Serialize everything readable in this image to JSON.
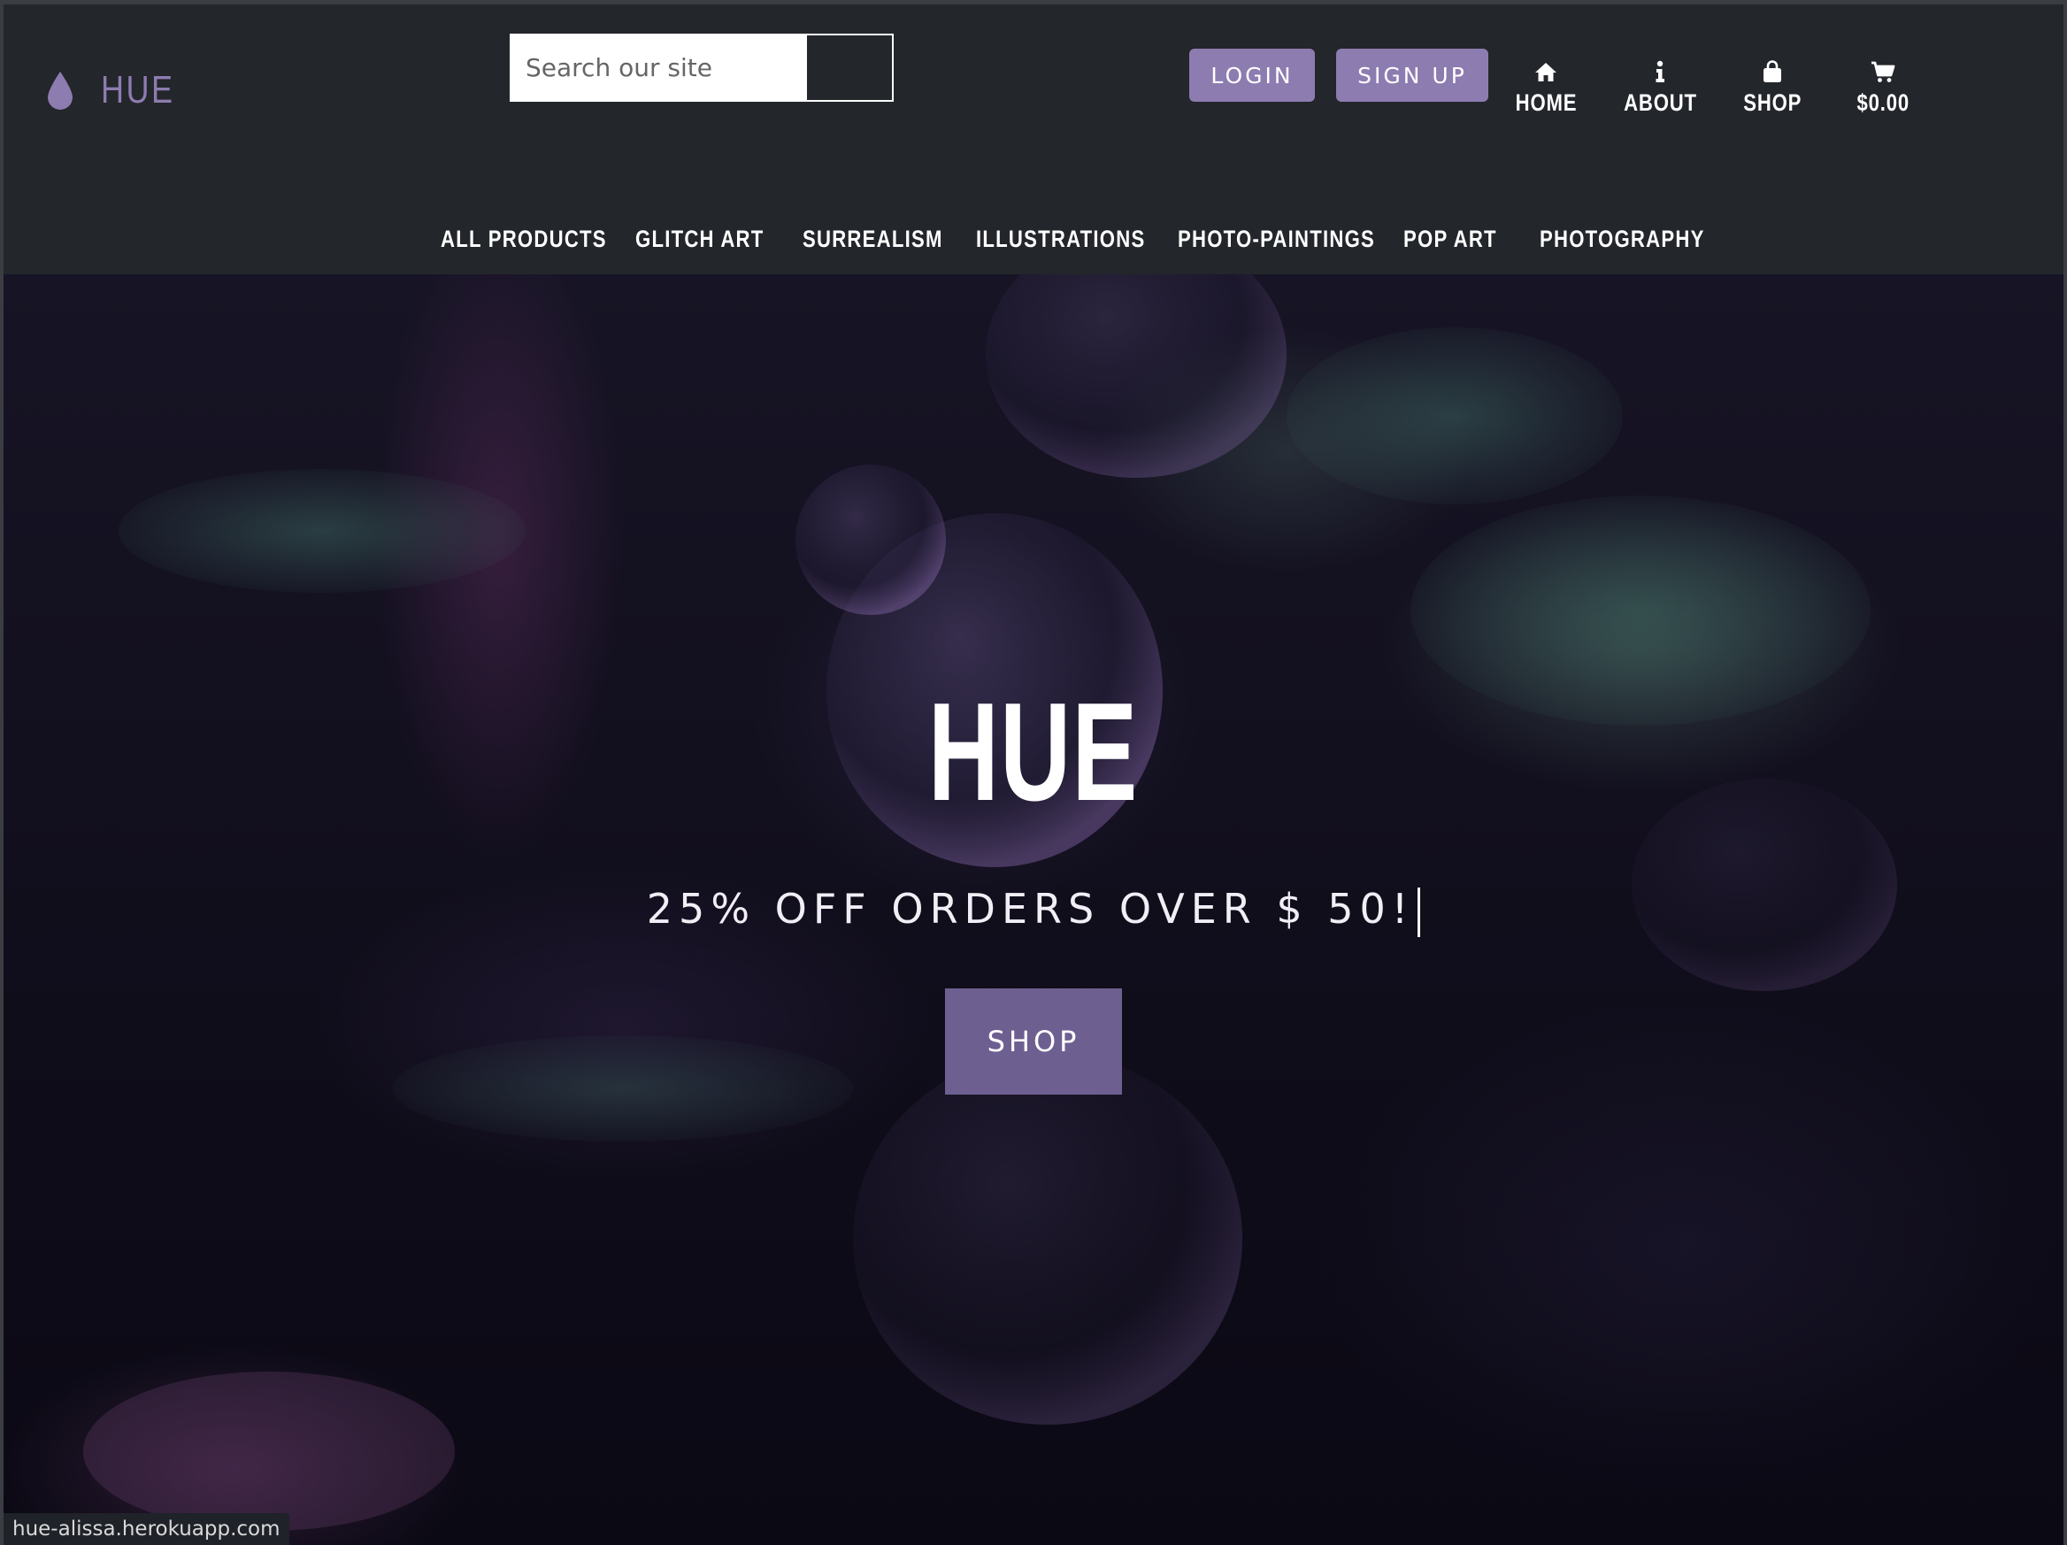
{
  "header": {
    "brand": {
      "icon": "droplet-icon",
      "name": "HUE"
    },
    "search": {
      "placeholder": "Search our site",
      "value": ""
    },
    "auth": {
      "login_label": "LOGIN",
      "signup_label": "SIGN UP"
    },
    "nav": [
      {
        "icon": "home-icon",
        "label": "HOME"
      },
      {
        "icon": "info-icon",
        "label": "ABOUT"
      },
      {
        "icon": "shopping-bag-icon",
        "label": "SHOP"
      },
      {
        "icon": "cart-icon",
        "label": "$0.00"
      }
    ],
    "categories": [
      "ALL PRODUCTS",
      "GLITCH ART",
      "SURREALISM",
      "ILLUSTRATIONS",
      "PHOTO-PAINTINGS",
      "POP ART",
      "PHOTOGRAPHY"
    ]
  },
  "hero": {
    "title": "HUE",
    "promo": "25% OFF ORDERS OVER $ 50!",
    "button_label": "SHOP"
  },
  "status_bar": {
    "url": "hue-alissa.herokuapp.com"
  },
  "colors": {
    "header_bg": "#23262b",
    "accent": "#8d7cb0",
    "hero_button": "#6e5f91",
    "text": "#ffffff"
  }
}
